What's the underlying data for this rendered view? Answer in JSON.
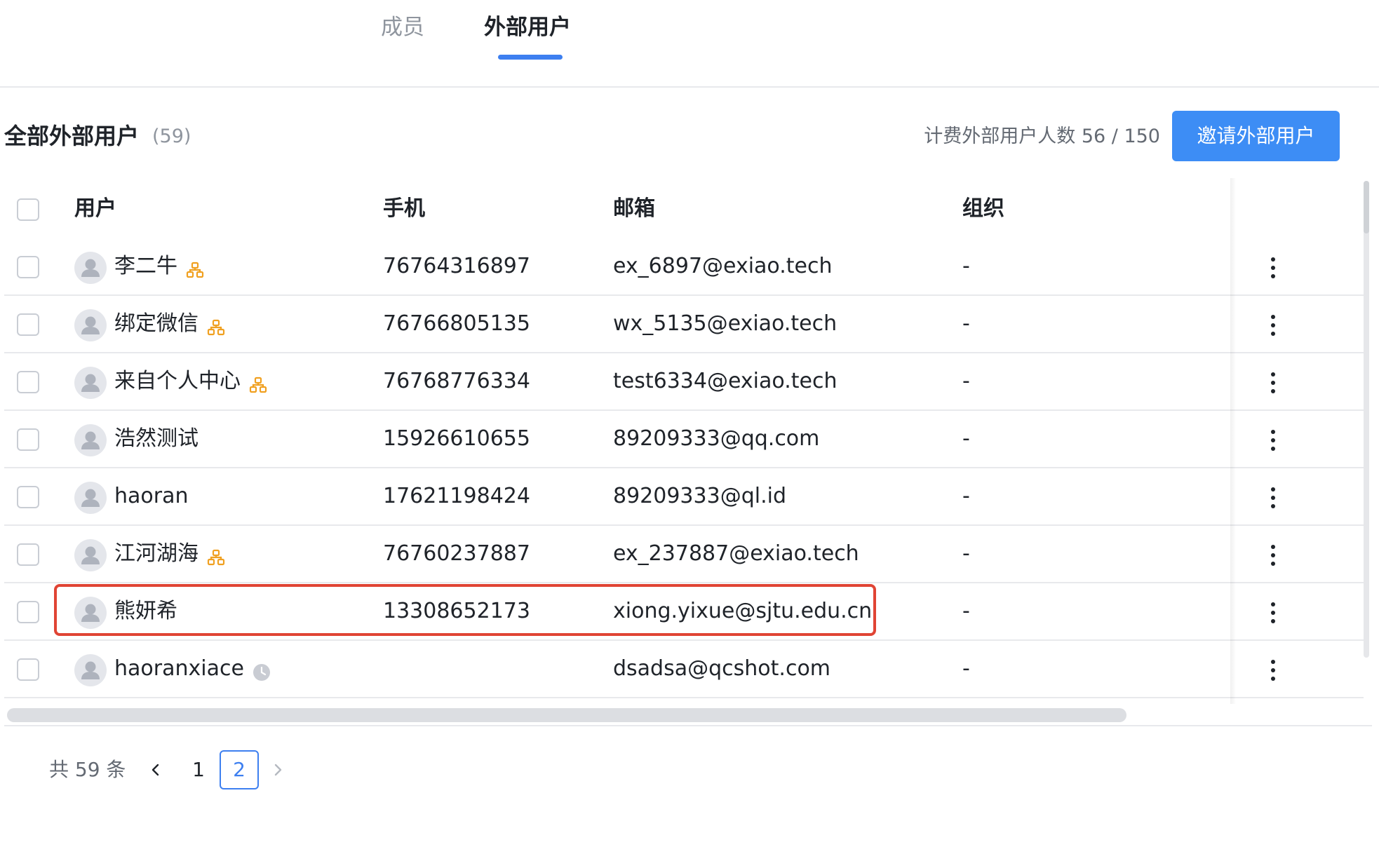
{
  "tabs": [
    {
      "label": "成员",
      "active": false
    },
    {
      "label": "外部用户",
      "active": true
    }
  ],
  "header": {
    "title": "全部外部用户",
    "count": "(59)",
    "billing": "计费外部用户人数 56 / 150",
    "invite_label": "邀请外部用户"
  },
  "table": {
    "columns": [
      "用户",
      "手机",
      "邮箱",
      "组织"
    ],
    "rows": [
      {
        "name": "李二牛",
        "phone": "76764316897",
        "email": "ex_6897@exiao.tech",
        "org": "-",
        "badge": "org-tree-icon"
      },
      {
        "name": "绑定微信",
        "phone": "76766805135",
        "email": "wx_5135@exiao.tech",
        "org": "-",
        "badge": "org-tree-icon"
      },
      {
        "name": "来自个人中心",
        "phone": "76768776334",
        "email": "test6334@exiao.tech",
        "org": "-",
        "badge": "org-tree-icon"
      },
      {
        "name": "浩然测试",
        "phone": "15926610655",
        "email": "89209333@qq.com",
        "org": "-",
        "badge": ""
      },
      {
        "name": "haoran",
        "phone": "17621198424",
        "email": "89209333@ql.id",
        "org": "-",
        "badge": ""
      },
      {
        "name": "江河湖海",
        "phone": "76760237887",
        "email": "ex_237887@exiao.tech",
        "org": "-",
        "badge": "org-tree-icon"
      },
      {
        "name": "熊妍希",
        "phone": "13308652173",
        "email": "xiong.yixue@sjtu.edu.cn",
        "org": "-",
        "badge": ""
      },
      {
        "name": "haoranxiace",
        "phone": "",
        "email": "dsadsa@qcshot.com",
        "org": "-",
        "badge": "clock-icon"
      }
    ]
  },
  "pagination": {
    "total": "共 59 条",
    "pages": [
      "1",
      "2"
    ],
    "current": "2"
  },
  "colors": {
    "accent": "#3d7ff0",
    "button": "#3d8df5",
    "org_icon": "#f0a020",
    "highlight": "#e04434"
  }
}
